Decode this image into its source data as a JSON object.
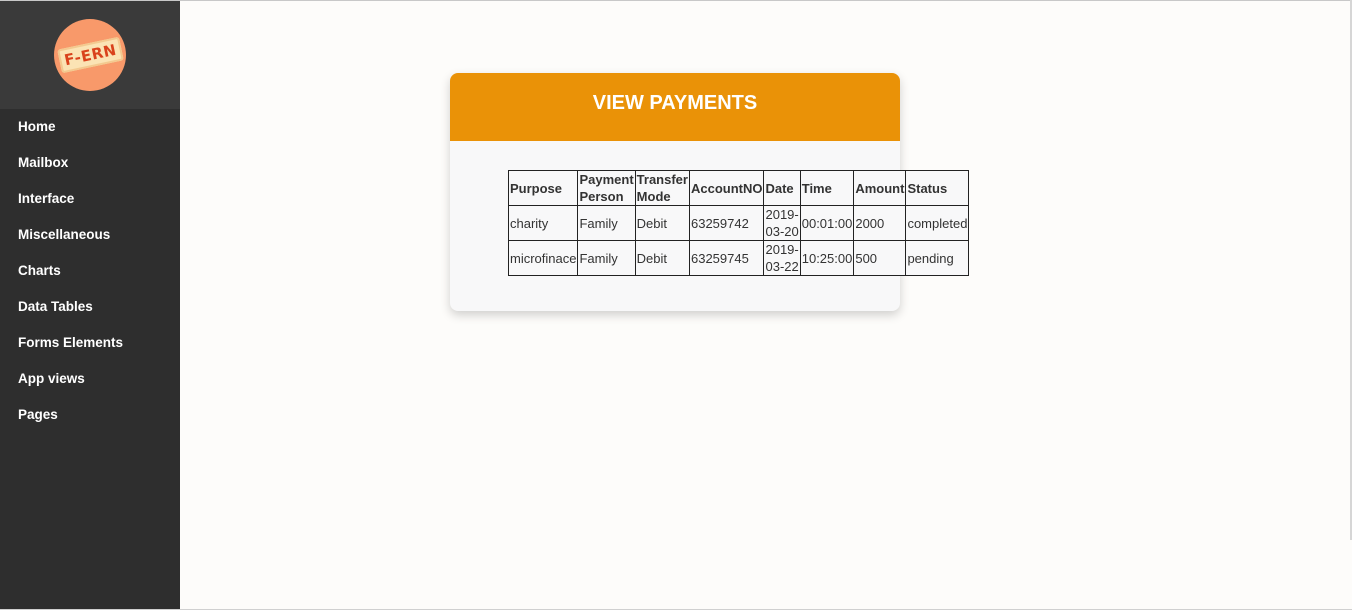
{
  "sidebar": {
    "logo_text": "F-ERN",
    "items": [
      {
        "label": "Home"
      },
      {
        "label": "Mailbox"
      },
      {
        "label": "Interface"
      },
      {
        "label": "Miscellaneous"
      },
      {
        "label": "Charts"
      },
      {
        "label": "Data Tables"
      },
      {
        "label": "Forms Elements"
      },
      {
        "label": "App views"
      },
      {
        "label": "Pages"
      }
    ]
  },
  "card": {
    "title": "VIEW PAYMENTS",
    "header_color": "#ea9207"
  },
  "table": {
    "headers": [
      "Purpose",
      "Payment Person",
      "Transfer Mode",
      "AccountNO",
      "Date",
      "Time",
      "Amount",
      "Status"
    ],
    "rows": [
      [
        "charity",
        "Family",
        "Debit",
        "63259742",
        "2019-03-20",
        "00:01:00",
        "2000",
        "completed"
      ],
      [
        "microfinace",
        "Family",
        "Debit",
        "63259745",
        "2019-03-22",
        "10:25:00",
        "500",
        "pending"
      ]
    ]
  }
}
